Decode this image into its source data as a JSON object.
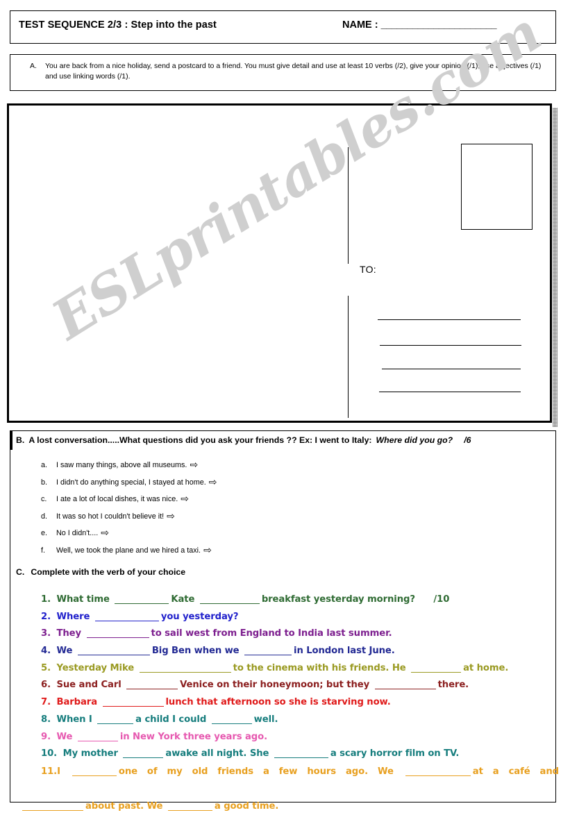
{
  "header": {
    "title": "TEST SEQUENCE 2/3 : Step into the past",
    "name_label": "NAME : ",
    "name_line": "______________________"
  },
  "instruction_a": {
    "letter": "A.",
    "text": "You are back from a nice holiday, send a postcard to a friend. You must give detail and use at least 10 verbs (/2), give your opinion (/1), use adjectives (/1) and use linking words (/1)."
  },
  "postcard": {
    "to_label": "TO:",
    "address_lines": 4,
    "stamp_box": "stamp-area"
  },
  "watermark": {
    "text": "ESLprintables.com",
    "color": "#cfcfcf"
  },
  "section_b": {
    "letter": "B.",
    "heading": "A lost conversation.....What questions did you ask your friends ?? Ex: I went to Italy:",
    "example_italic": "Where did you go?",
    "score": "/6",
    "arrow_glyph": "⇨",
    "items": [
      {
        "index": "a.",
        "text": "I saw many things, above all museums."
      },
      {
        "index": "b.",
        "text": "I didn't do anything special, I stayed at home."
      },
      {
        "index": "c.",
        "text": "I ate a lot of local dishes, it was nice."
      },
      {
        "index": "d.",
        "text": "It was so hot I couldn't believe it!"
      },
      {
        "index": "e.",
        "text": "No I didn't...."
      },
      {
        "index": "f.",
        "text": "Well, we took the plane and we hired a taxi."
      }
    ]
  },
  "section_c": {
    "letter": "C.",
    "heading": "Complete with the verb of your choice",
    "score": "/10",
    "items": [
      {
        "num": "1.",
        "color": "#2f6b33",
        "parts": [
          "What time",
          "BLANK:78",
          "Kate",
          "BLANK:86",
          "breakfast yesterday morning?"
        ],
        "score": "/10"
      },
      {
        "num": "2.",
        "color": "#2222cc",
        "parts": [
          "Where",
          "BLANK:92",
          "you yesterday?"
        ]
      },
      {
        "num": "3.",
        "color": "#7d1f8f",
        "parts": [
          "They",
          "BLANK:90",
          "to sail west from England to India last summer."
        ]
      },
      {
        "num": "4.",
        "color": "#232a94",
        "parts": [
          "We",
          "BLANK:104",
          "Big Ben when we",
          "BLANK:68",
          "in London last June."
        ]
      },
      {
        "num": "5.",
        "color": "#9a9a22",
        "parts": [
          "Yesterday Mike",
          "BLANK:132",
          "to the cinema with his friends. He",
          "BLANK:72",
          "at home."
        ]
      },
      {
        "num": "6.",
        "color": "#8c2020",
        "parts": [
          "Sue and Carl",
          "BLANK:74",
          "Venice on their honeymoon; but they",
          "BLANK:88",
          "there."
        ]
      },
      {
        "num": "7.",
        "color": "#e01b1b",
        "parts": [
          "Barbara",
          "BLANK:88",
          "lunch that afternoon so she is starving now."
        ]
      },
      {
        "num": "8.",
        "color": "#167d7d",
        "parts": [
          "When I",
          "BLANK:52",
          "a child I could",
          "BLANK:58",
          "well."
        ]
      },
      {
        "num": "9.",
        "color": "#e659b0",
        "parts": [
          "We",
          "BLANK:58",
          "in New York three years ago."
        ]
      },
      {
        "num": "10.",
        "color": "#167d7d",
        "parts": [
          "My mother",
          "BLANK:58",
          "awake all night. She",
          "BLANK:78",
          "a scary horror film on TV."
        ]
      }
    ],
    "item_11": {
      "num": "11.",
      "color": "#e8a020",
      "row1": [
        "I",
        "BLANK:64",
        "one of my old friends a few hours ago. We",
        "BLANK:94",
        "at a café and"
      ],
      "row2": [
        "BLANK:88",
        "about past. We",
        "BLANK:64",
        "a good time."
      ]
    }
  }
}
